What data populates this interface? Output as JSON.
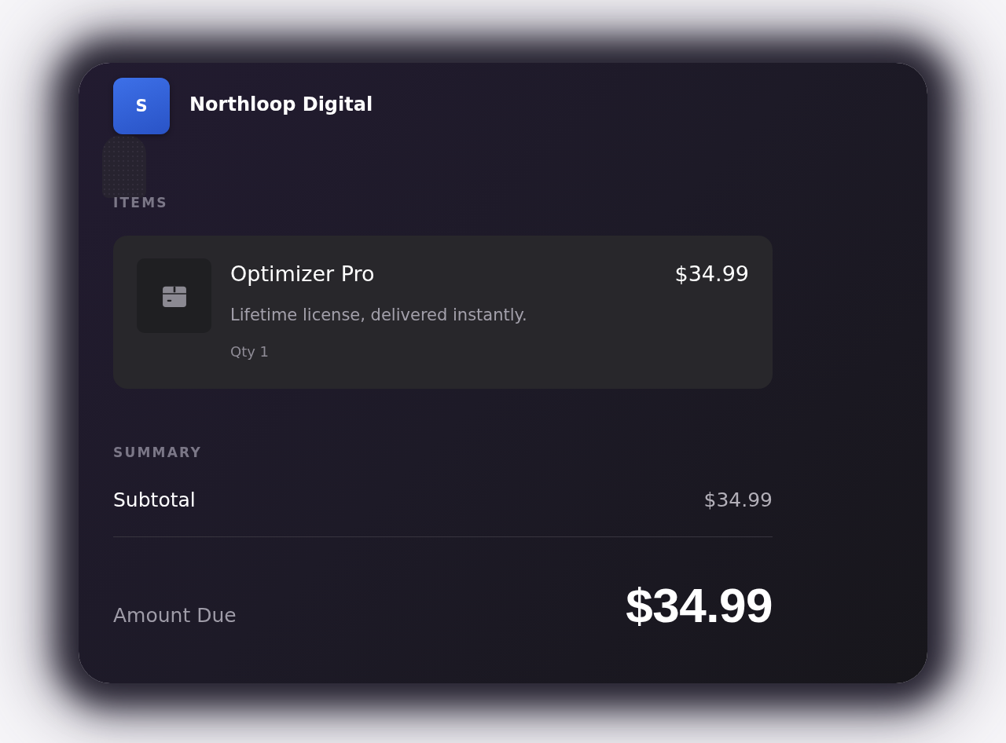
{
  "merchant": {
    "logo_letter": "S",
    "name": "Northloop Digital"
  },
  "items_section": {
    "heading": "ITEMS",
    "items": [
      {
        "name": "Optimizer Pro",
        "price": "$34.99",
        "description": "Lifetime license, delivered instantly.",
        "quantity": "Qty 1"
      }
    ]
  },
  "summary": {
    "heading": "SUMMARY",
    "rows": [
      {
        "label": "Subtotal",
        "value": "$34.99"
      }
    ],
    "total": {
      "label": "Amount Due",
      "value": "$34.99"
    }
  }
}
